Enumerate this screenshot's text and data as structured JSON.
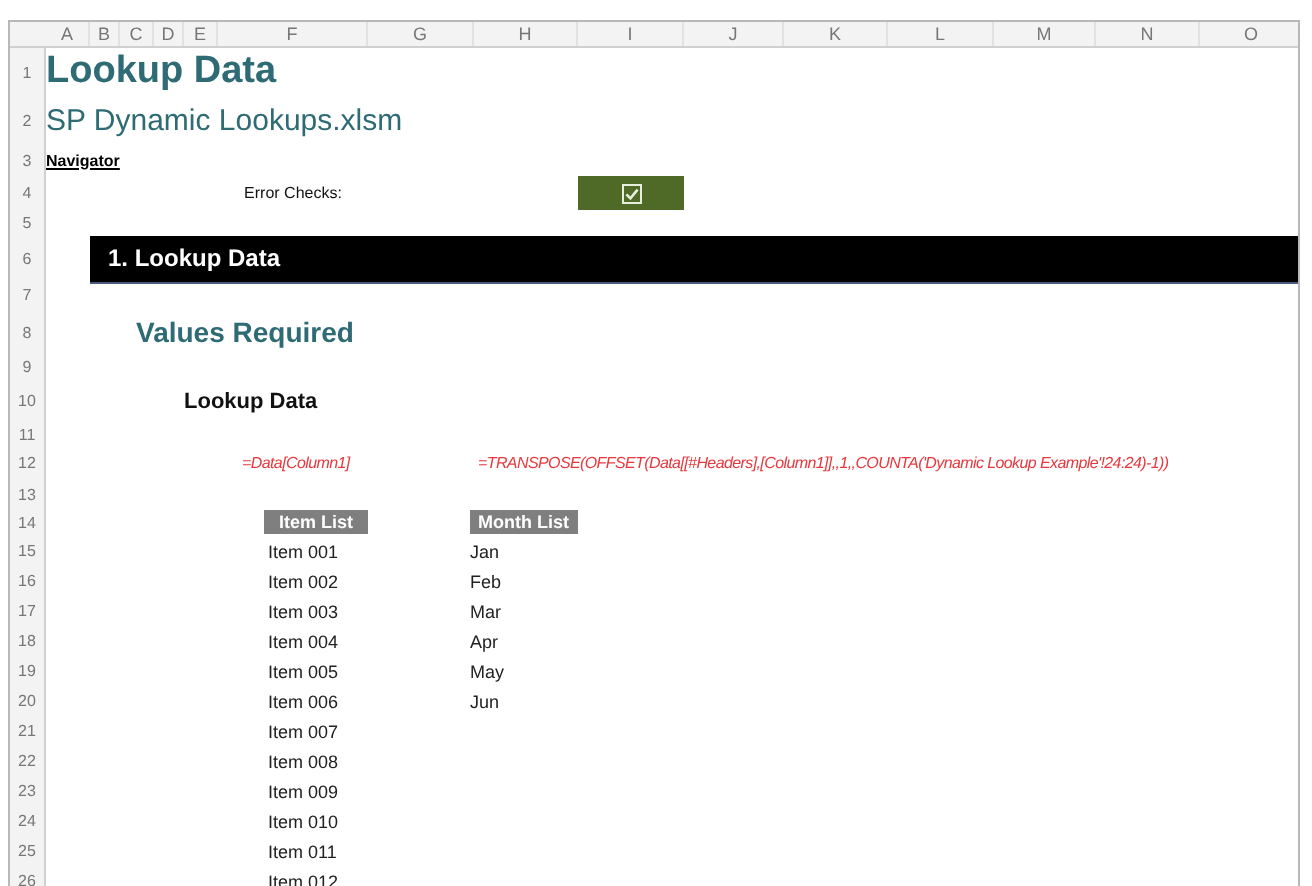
{
  "column_headers": [
    "A",
    "B",
    "C",
    "D",
    "E",
    "F",
    "G",
    "H",
    "I",
    "J",
    "K",
    "L",
    "M",
    "N",
    "O"
  ],
  "row_numbers": [
    "1",
    "2",
    "3",
    "4",
    "5",
    "6",
    "7",
    "8",
    "9",
    "10",
    "11",
    "12",
    "13",
    "14",
    "15",
    "16",
    "17",
    "18",
    "19",
    "20",
    "21",
    "22",
    "23",
    "24",
    "25",
    "26"
  ],
  "title": "Lookup Data",
  "subtitle": "SP Dynamic Lookups.xlsm",
  "navigator_link": "Navigator",
  "error_checks": {
    "label": "Error Checks:",
    "checked": true
  },
  "section": {
    "title": "1. Lookup Data"
  },
  "values_required": "Values Required",
  "subheading": "Lookup Data",
  "formulas": [
    "=Data[Column1]",
    "=TRANSPOSE(OFFSET(Data[[#Headers],[Column1]],,1,,COUNTA('Dynamic Lookup Example'!24:24)-1))"
  ],
  "lists": [
    {
      "header": "Item List",
      "values": [
        "Item 001",
        "Item 002",
        "Item 003",
        "Item 004",
        "Item 005",
        "Item 006",
        "Item 007",
        "Item 008",
        "Item 009",
        "Item 010",
        "Item 011",
        "Item 012"
      ]
    },
    {
      "header": "Month List",
      "values": [
        "Jan",
        "Feb",
        "Mar",
        "Apr",
        "May",
        "Jun"
      ]
    }
  ]
}
